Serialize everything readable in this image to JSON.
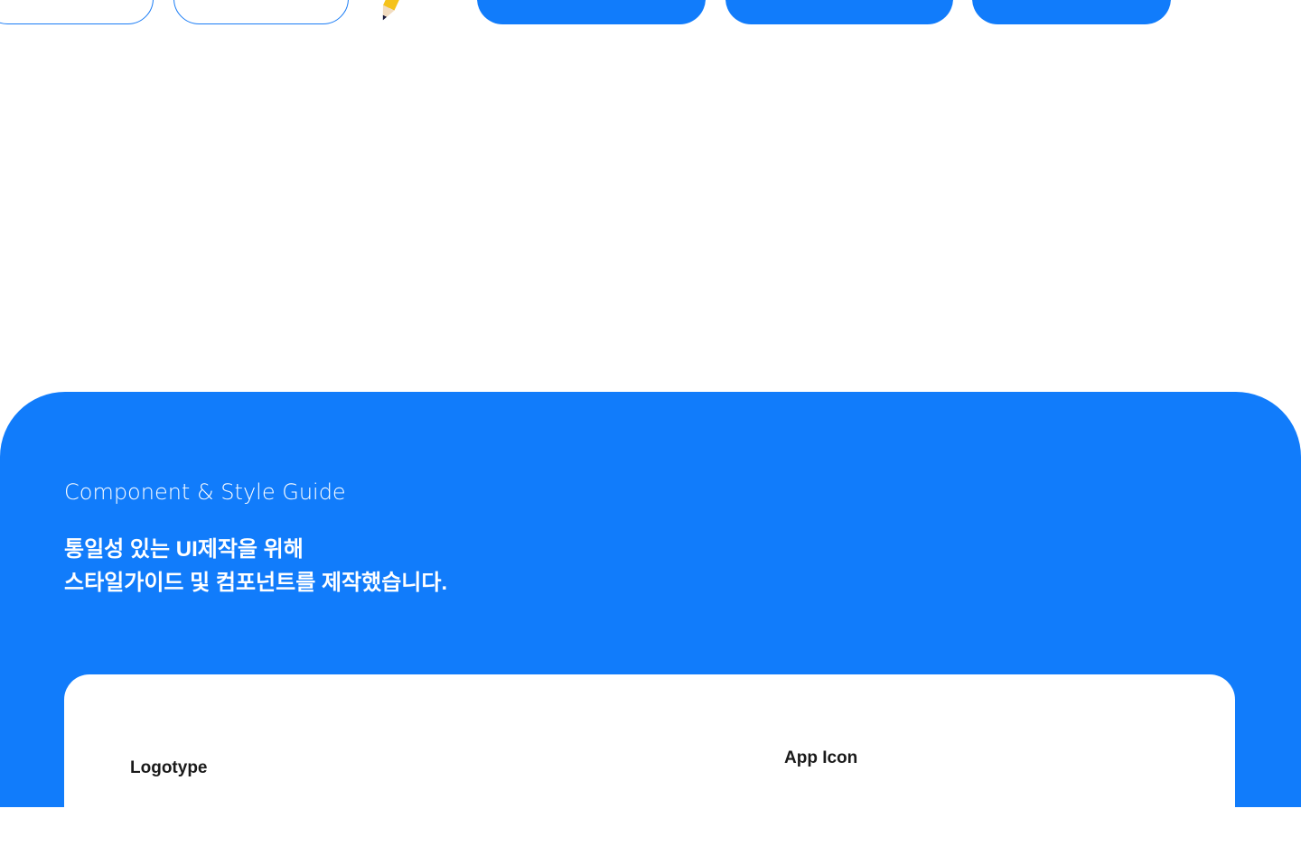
{
  "hero": {
    "subtitle": "Component & Style Guide",
    "headline_line1": "통일성  있는 UI제작을 위해",
    "headline_line2": "스타일가이드 및 컴포넌트를 제작했습니다."
  },
  "card": {
    "logotype_label": "Logotype",
    "app_icon_label": "App Icon"
  },
  "colors": {
    "primary": "#117cfb"
  }
}
